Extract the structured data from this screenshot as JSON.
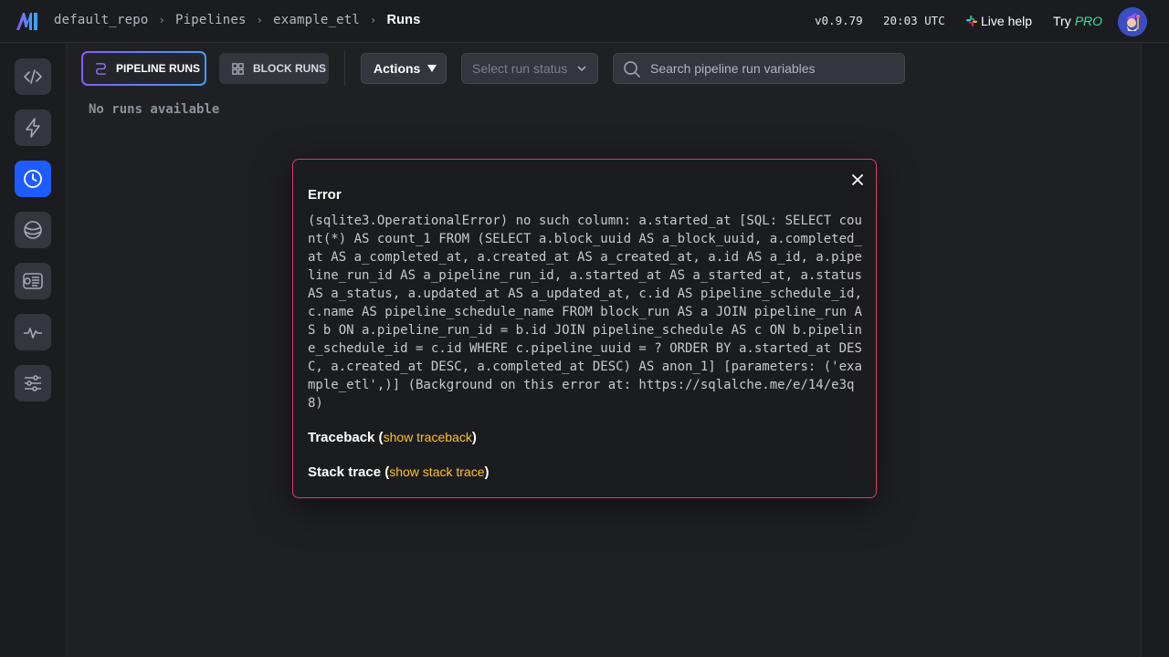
{
  "breadcrumb": {
    "repo": "default_repo",
    "pipelines": "Pipelines",
    "pipeline": "example_etl",
    "current": "Runs"
  },
  "header": {
    "version": "v0.9.79",
    "time": "20:03 UTC",
    "live_help": "Live help",
    "try": "Try",
    "pro": "PRO"
  },
  "sidebar": {
    "items": [
      {
        "icon": "code-icon"
      },
      {
        "icon": "lightning-icon"
      },
      {
        "icon": "clock-icon",
        "active": true
      },
      {
        "icon": "planet-icon"
      },
      {
        "icon": "terminal-icon"
      },
      {
        "icon": "monitor-icon"
      },
      {
        "icon": "settings-sliders-icon"
      }
    ]
  },
  "toolbar": {
    "pipeline_runs": "PIPELINE RUNS",
    "block_runs": "BLOCK RUNS",
    "actions": "Actions",
    "status_placeholder": "Select run status",
    "search_placeholder": "Search pipeline run variables"
  },
  "main": {
    "empty_text": "No runs available"
  },
  "error_modal": {
    "title": "Error",
    "message": "(sqlite3.OperationalError) no such column: a.started_at [SQL: SELECT count(*) AS count_1 FROM (SELECT a.block_uuid AS a_block_uuid, a.completed_at AS a_completed_at, a.created_at AS a_created_at, a.id AS a_id, a.pipeline_run_id AS a_pipeline_run_id, a.started_at AS a_started_at, a.status AS a_status, a.updated_at AS a_updated_at, c.id AS pipeline_schedule_id, c.name AS pipeline_schedule_name FROM block_run AS a JOIN pipeline_run AS b ON a.pipeline_run_id = b.id JOIN pipeline_schedule AS c ON b.pipeline_schedule_id = c.id WHERE c.pipeline_uuid = ? ORDER BY a.started_at DESC, a.created_at DESC, a.completed_at DESC) AS anon_1] [parameters: ('example_etl',)] (Background on this error at: https://sqlalche.me/e/14/e3q8)",
    "traceback_label": "Traceback",
    "traceback_link": "show traceback",
    "stack_label": "Stack trace",
    "stack_link": "show stack trace",
    "border_color": "#e8336b",
    "link_color": "#ffc31f"
  },
  "colors": {
    "accent": "#1f5cff",
    "pro": "#2ee59d"
  }
}
